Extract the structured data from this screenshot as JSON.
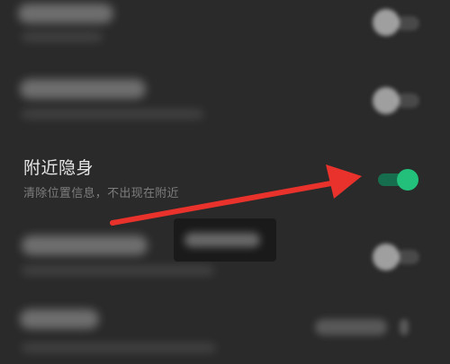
{
  "settings": {
    "highlighted_item": {
      "title": "附近隐身",
      "subtitle": "清除位置信息，不出现在附近",
      "toggle_on": true
    }
  },
  "colors": {
    "background": "#2a2a2a",
    "toggle_on": "#22c07a",
    "toggle_track": "#166e4e",
    "annotation_arrow": "#e8322b"
  },
  "icons": {
    "annotation": "red-arrow-icon"
  }
}
